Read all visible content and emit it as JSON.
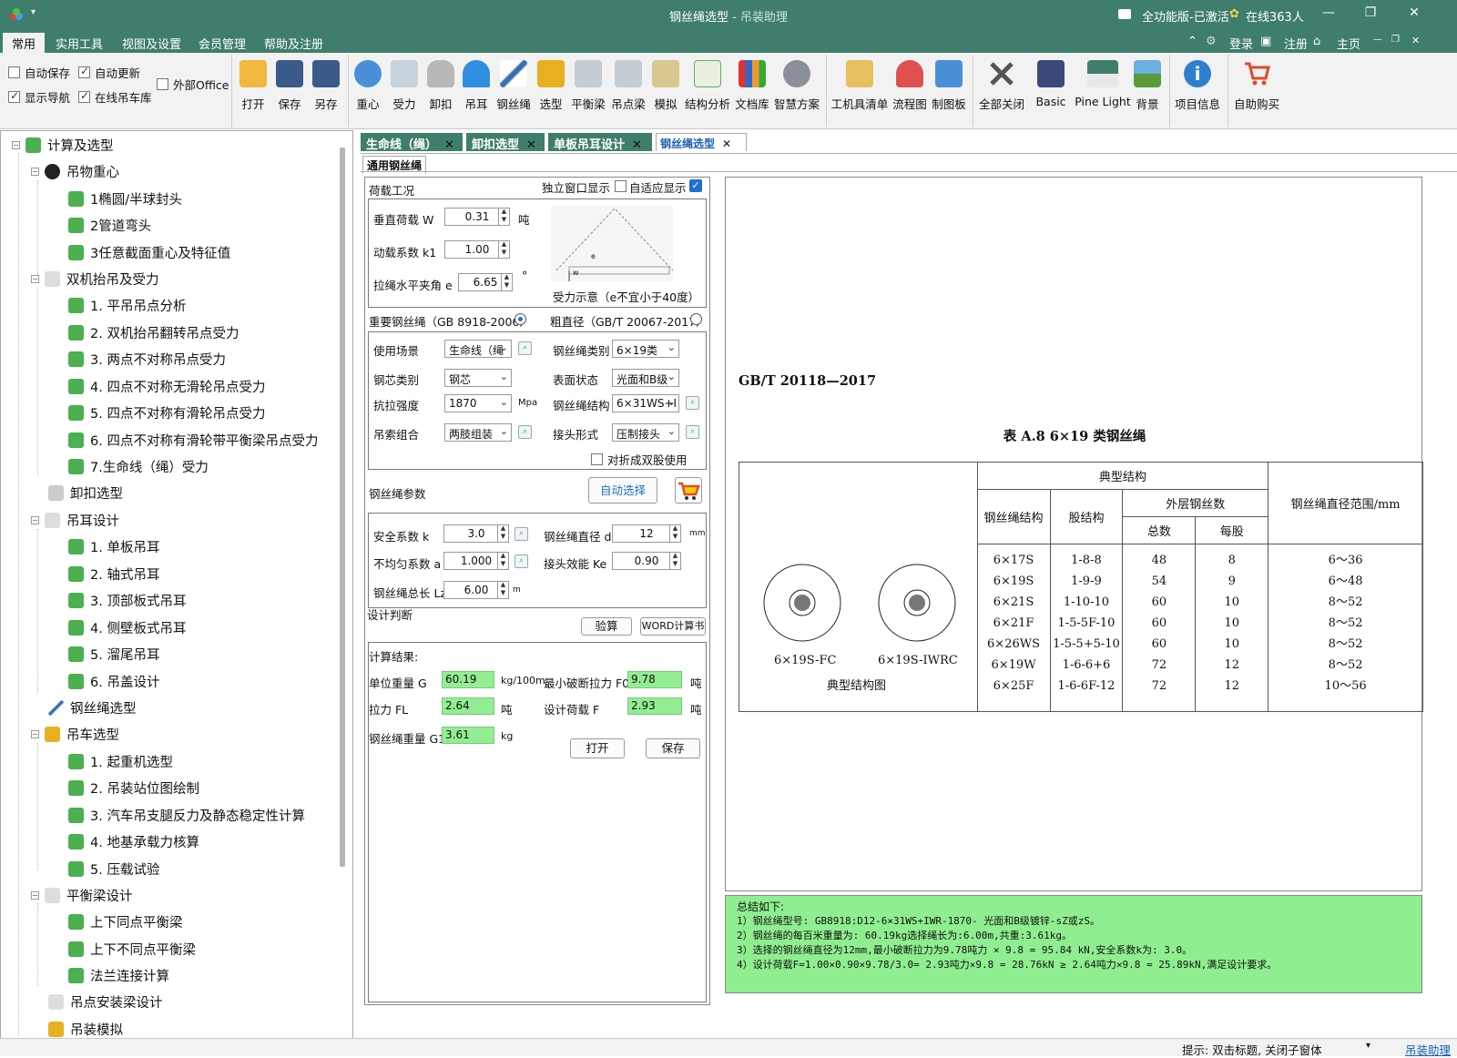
{
  "window": {
    "title_main": "钢丝绳选型",
    "title_sep": " - ",
    "title_app": "吊装助理",
    "edition": "全功能版-已激活",
    "online": "在线363人"
  },
  "menubar": {
    "items": [
      "常用",
      "实用工具",
      "视图及设置",
      "会员管理",
      "帮助及注册"
    ],
    "right": [
      "登录",
      "注册",
      "主页"
    ]
  },
  "ribbon": {
    "checks": [
      {
        "label": "自动保存",
        "checked": false
      },
      {
        "label": "自动更新",
        "checked": true
      },
      {
        "label": "外部Office",
        "checked": false
      },
      {
        "label": "显示导航",
        "checked": true
      },
      {
        "label": "在线吊车库",
        "checked": true
      }
    ],
    "file_buttons": [
      "打开",
      "保存",
      "另存"
    ],
    "tool_buttons": [
      "重心",
      "受力",
      "卸扣",
      "吊耳",
      "钢丝绳",
      "选型",
      "平衡梁",
      "吊点梁",
      "模拟",
      "结构分析",
      "文档库",
      "智慧方案"
    ],
    "other_buttons": [
      "工机具清单",
      "流程图",
      "制图板"
    ],
    "view_buttons": [
      "全部关闭",
      "Basic",
      "Pine Light",
      "背景"
    ],
    "info_buttons": [
      "项目信息",
      "自助购买"
    ]
  },
  "tree": [
    {
      "label": "计算及选型",
      "level": 0
    },
    {
      "label": "吊物重心",
      "level": 1
    },
    {
      "label": "1椭圆/半球封头",
      "level": 2
    },
    {
      "label": "2管道弯头",
      "level": 2
    },
    {
      "label": "3任意截面重心及特征值",
      "level": 2
    },
    {
      "label": "双机抬吊及受力",
      "level": 1
    },
    {
      "label": "1. 平吊吊点分析",
      "level": 2
    },
    {
      "label": "2. 双机抬吊翻转吊点受力",
      "level": 2
    },
    {
      "label": "3. 两点不对称吊点受力",
      "level": 2
    },
    {
      "label": "4. 四点不对称无滑轮吊点受力",
      "level": 2
    },
    {
      "label": "5. 四点不对称有滑轮吊点受力",
      "level": 2
    },
    {
      "label": "6. 四点不对称有滑轮带平衡梁吊点受力",
      "level": 2
    },
    {
      "label": "7.生命线（绳）受力",
      "level": 2
    },
    {
      "label": "卸扣选型",
      "level": 1
    },
    {
      "label": "吊耳设计",
      "level": 1
    },
    {
      "label": "1. 单板吊耳",
      "level": 2
    },
    {
      "label": "2. 轴式吊耳",
      "level": 2
    },
    {
      "label": "3. 顶部板式吊耳",
      "level": 2
    },
    {
      "label": "4. 侧壁板式吊耳",
      "level": 2
    },
    {
      "label": "5. 溜尾吊耳",
      "level": 2
    },
    {
      "label": "6. 吊盖设计",
      "level": 2
    },
    {
      "label": "钢丝绳选型",
      "level": 1
    },
    {
      "label": "吊车选型",
      "level": 1
    },
    {
      "label": "1. 起重机选型",
      "level": 2
    },
    {
      "label": "2. 吊装站位图绘制",
      "level": 2
    },
    {
      "label": "3. 汽车吊支腿反力及静态稳定性计算",
      "level": 2
    },
    {
      "label": "4. 地基承载力核算",
      "level": 2
    },
    {
      "label": "5. 压载试验",
      "level": 2
    },
    {
      "label": "平衡梁设计",
      "level": 1
    },
    {
      "label": "上下同点平衡梁",
      "level": 2
    },
    {
      "label": "上下不同点平衡梁",
      "level": 2
    },
    {
      "label": "法兰连接计算",
      "level": 2
    },
    {
      "label": "吊点安装梁设计",
      "level": 1
    },
    {
      "label": "吊装模拟",
      "level": 1
    }
  ],
  "tabs": [
    "生命线（绳）",
    "卸扣选型",
    "单板吊耳设计",
    "钢丝绳选型"
  ],
  "subtab": "通用钢丝绳",
  "load": {
    "group_title": "荷载工况",
    "standalone": "独立窗口显示",
    "adaptive": "自适应显示",
    "vertical_label": "垂直荷载 W",
    "vertical_value": "0.31",
    "vertical_unit": "吨",
    "dynamic_label": "动载系数 k1",
    "dynamic_value": "1.00",
    "angle_label": "拉绳水平夹角 e",
    "angle_value": "6.65",
    "angle_unit": "°",
    "diagram_caption": "受力示意（e不宜小于40度）",
    "diagram_e": "e",
    "diagram_w": "w"
  },
  "standard": {
    "opt1": "重要钢丝绳（GB 8918-2006）",
    "opt2": "粗直径（GB/T 20067-2017）"
  },
  "select": {
    "scene_label": "使用场景",
    "scene_value": "生命线（绳",
    "type_label": "钢丝绳类别",
    "type_value": "6×19类",
    "core_label": "钢芯类别",
    "core_value": "钢芯",
    "surface_label": "表面状态",
    "surface_value": "光面和B级",
    "strength_label": "抗拉强度",
    "strength_value": "1870",
    "strength_unit": "Mpa",
    "struct_label": "钢丝绳结构",
    "struct_value": "6×31WS+I",
    "combo_label": "吊索组合",
    "combo_value": "两肢组装",
    "joint_label": "接头形式",
    "joint_value": "压制接头",
    "fold_label": "对折成双股使用"
  },
  "params": {
    "group_title": "钢丝绳参数",
    "auto_select": "自动选择",
    "safety_label": "安全系数 k",
    "safety_value": "3.0",
    "dia_label": "钢丝绳直径 d",
    "dia_value": "12",
    "dia_unit": "mm",
    "uneven_label": "不均匀系数 a",
    "uneven_value": "1.000",
    "eff_label": "接头效能 Ke",
    "eff_value": "0.90",
    "length_label": "钢丝绳总长 Lz",
    "length_value": "6.00",
    "length_unit": "m"
  },
  "design": {
    "title": "设计判断",
    "verify": "验算",
    "word": "WORD计算书"
  },
  "results": {
    "title": "计算结果:",
    "unit_weight_label": "单位重量 G",
    "unit_weight_value": "60.19",
    "unit_weight_unit": "kg/100m",
    "min_break_label": "最小破断拉力 F0",
    "min_break_value": "9.78",
    "min_break_unit": "吨",
    "tension_label": "拉力 FL",
    "tension_value": "2.64",
    "tension_unit": "吨",
    "design_load_label": "设计荷载 F",
    "design_load_value": "2.93",
    "design_load_unit": "吨",
    "rope_weight_label": "钢丝绳重量 G1",
    "rope_weight_value": "3.61",
    "rope_weight_unit": "kg",
    "open": "打开",
    "save": "保存"
  },
  "standard_doc": {
    "code": "GB/T 20118—2017",
    "table_title": "表 A.8   6×19 类钢丝绳",
    "header_typical": "典型结构",
    "header_rope": "钢丝绳结构",
    "header_strand": "股结构",
    "header_outer": "外层钢丝数",
    "header_total": "总数",
    "header_per": "每股",
    "header_dia": "钢丝绳直径范围/mm",
    "img_label1": "6×19S-FC",
    "img_label2": "6×19S-IWRC",
    "img_caption": "典型结构图",
    "rows": [
      [
        "6×17S",
        "1-8-8",
        "48",
        "8",
        "6～36"
      ],
      [
        "6×19S",
        "1-9-9",
        "54",
        "9",
        "6～48"
      ],
      [
        "6×21S",
        "1-10-10",
        "60",
        "10",
        "8～52"
      ],
      [
        "6×21F",
        "1-5-5F-10",
        "60",
        "10",
        "8～52"
      ],
      [
        "6×26WS",
        "1-5-5+5-10",
        "60",
        "10",
        "8～52"
      ],
      [
        "6×19W",
        "1-6-6+6",
        "72",
        "12",
        "8～52"
      ],
      [
        "6×25F",
        "1-6-6F-12",
        "72",
        "12",
        "10～56"
      ]
    ]
  },
  "summary": {
    "title": "总结如下:",
    "lines": [
      "1）钢丝绳型号: GB8918:D12-6×31WS+IWR-1870- 光面和B级镀锌-sZ或zS。",
      "2）钢丝绳的每百米重量为: 60.19kg选择绳长为:6.00m,共重:3.61kg。",
      "3）选择的钢丝绳直径为12mm,最小破断拉力为9.78吨力 × 9.8 = 95.84 kN,安全系数k为: 3.0。",
      "4）设计荷载F=1.00×0.90×9.78/3.0= 2.93吨力×9.8 = 28.76kN ≥ 2.64吨力×9.8 = 25.89kN,满足设计要求。"
    ]
  },
  "status": {
    "hint": "提示: 双击标题, 关闭子窗体",
    "link": "吊装助理"
  },
  "colors": {
    "titlebar": "#3f7e6c",
    "result_green": "#93ee93",
    "summary_green": "#8fee8f",
    "tab_text": "#1b5fb5"
  }
}
